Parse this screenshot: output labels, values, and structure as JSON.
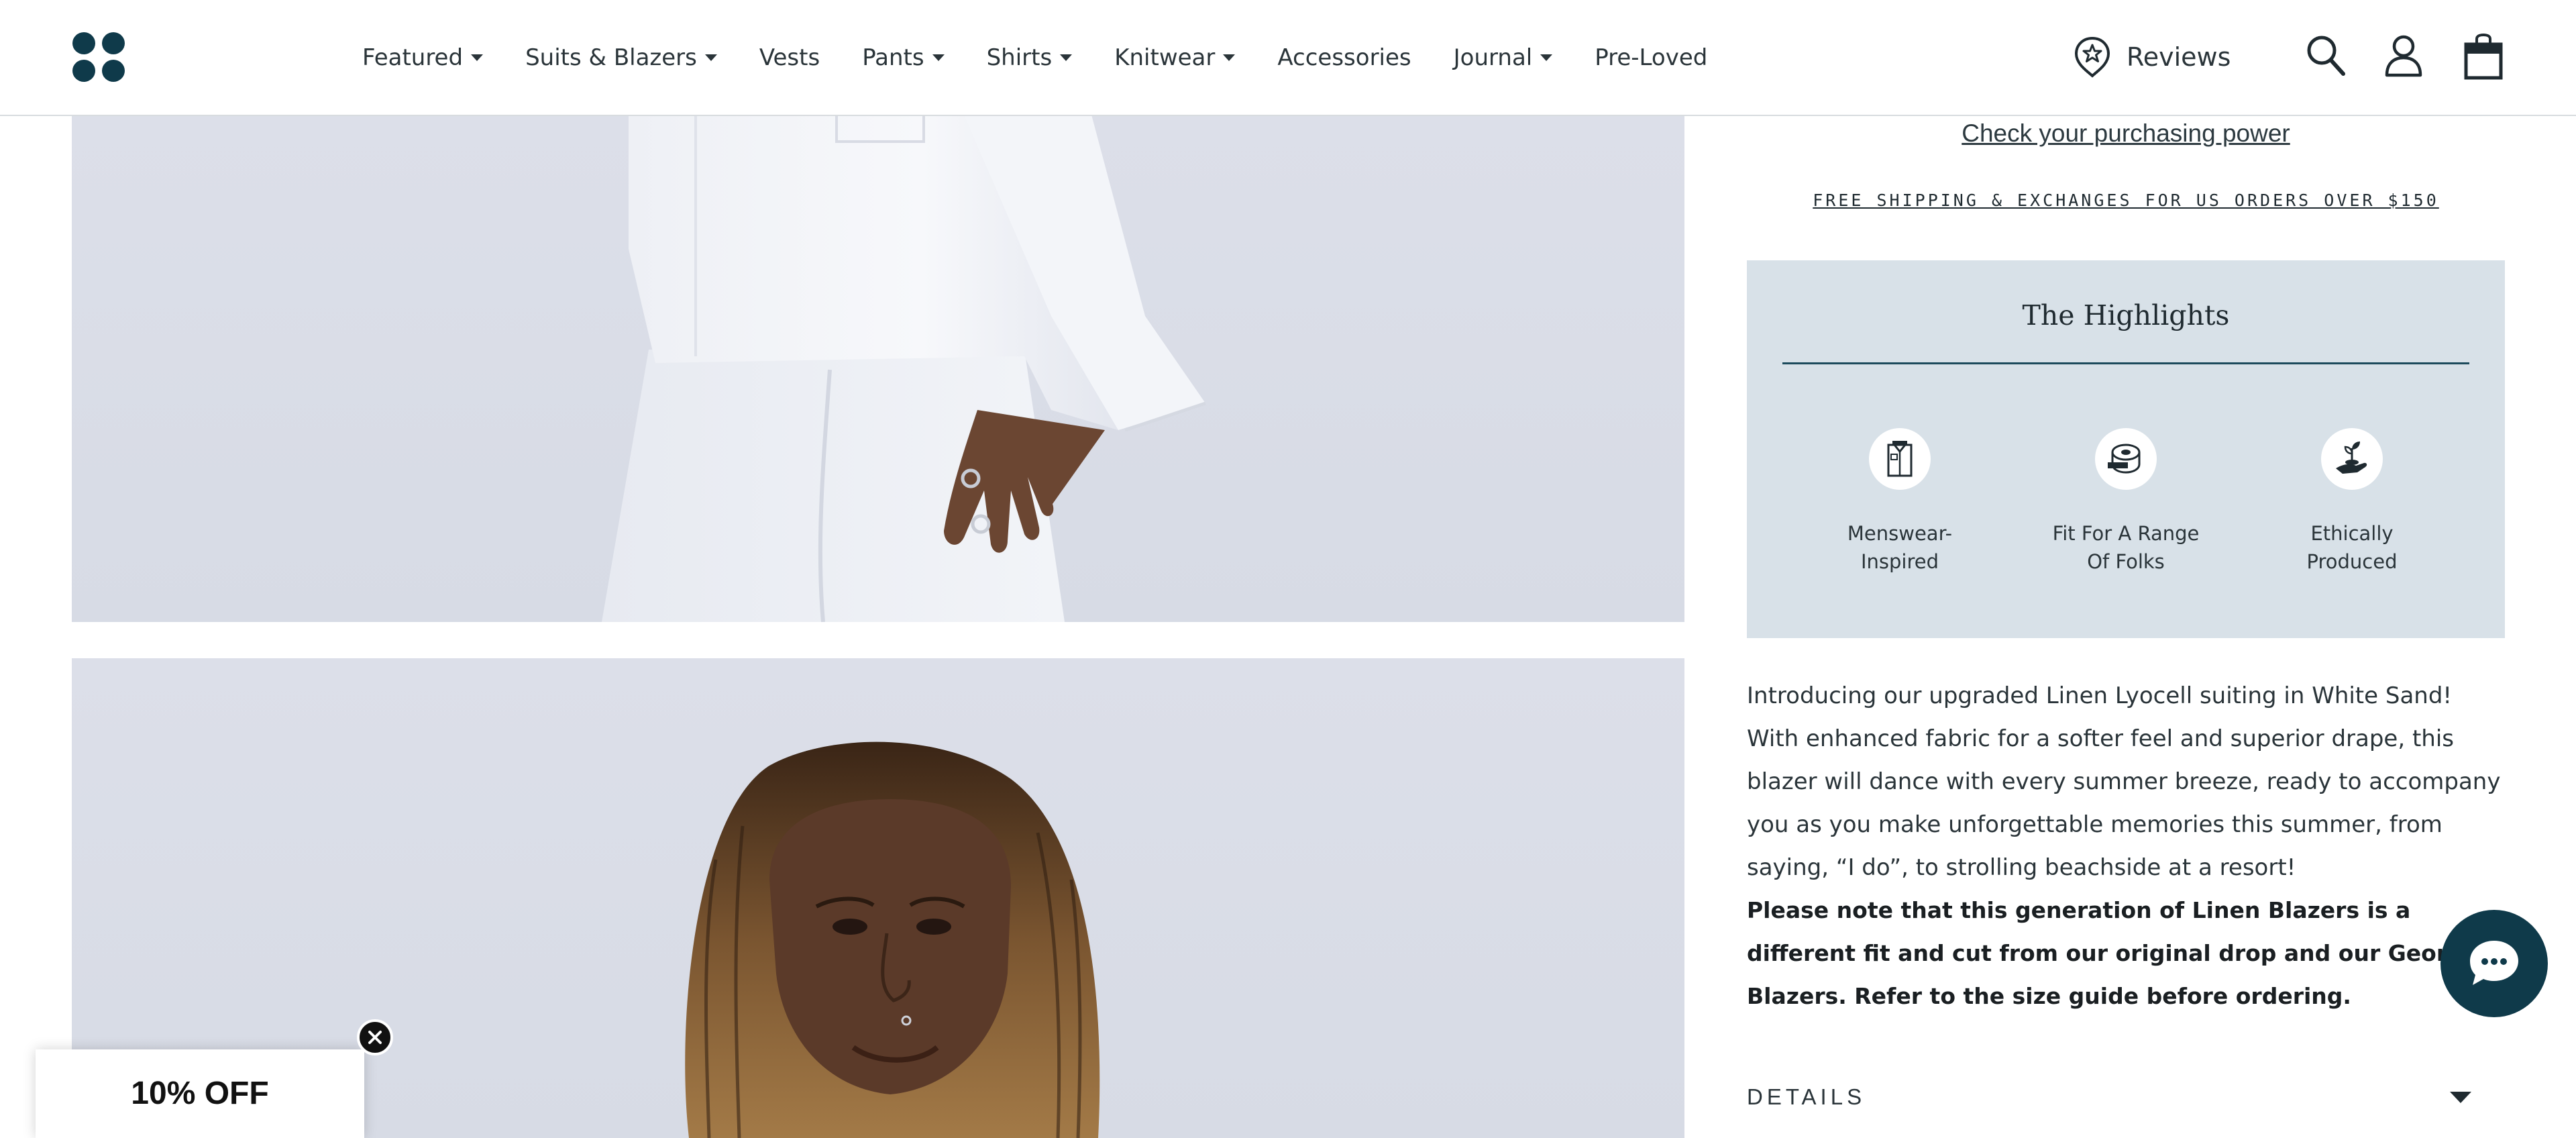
{
  "header": {
    "nav": [
      {
        "label": "Featured",
        "dropdown": true
      },
      {
        "label": "Suits & Blazers",
        "dropdown": true
      },
      {
        "label": "Vests",
        "dropdown": false
      },
      {
        "label": "Pants",
        "dropdown": true
      },
      {
        "label": "Shirts",
        "dropdown": true
      },
      {
        "label": "Knitwear",
        "dropdown": true
      },
      {
        "label": "Accessories",
        "dropdown": false
      },
      {
        "label": "Journal",
        "dropdown": true
      },
      {
        "label": "Pre-Loved",
        "dropdown": false
      }
    ],
    "reviews_label": "Reviews",
    "icons": [
      "logo-icon",
      "reviews-badge-icon",
      "search-icon",
      "account-icon",
      "cart-icon"
    ]
  },
  "product": {
    "purchasing_power_link": "Check your purchasing power",
    "shipping_banner": "FREE SHIPPING & EXCHANGES FOR US ORDERS OVER $150",
    "highlights": {
      "title": "The Highlights",
      "items": [
        {
          "label": "Menswear-Inspired",
          "icon": "shirt-icon"
        },
        {
          "label": "Fit For A Range Of Folks",
          "icon": "measuring-tape-icon"
        },
        {
          "label": "Ethically Produced",
          "icon": "hand-plant-icon"
        }
      ]
    },
    "description": "Introducing our upgraded Linen Lyocell suiting in White Sand! With enhanced fabric for a softer feel and superior drape, this blazer will dance with every summer breeze, ready to accompany you as you make unforgettable memories this summer, from saying, “I do”, to strolling beachside at a resort!",
    "note": "Please note that this generation of Linen Blazers is a different fit and cut from our original drop and our Georgie Blazers. Refer to the size guide before ordering.",
    "details_label": "DETAILS"
  },
  "promo": {
    "label": "10% OFF"
  },
  "colors": {
    "brand": "#0f3a4a",
    "highlights_bg": "#d8e1e8",
    "photo_bg": "#dcdfe9"
  }
}
